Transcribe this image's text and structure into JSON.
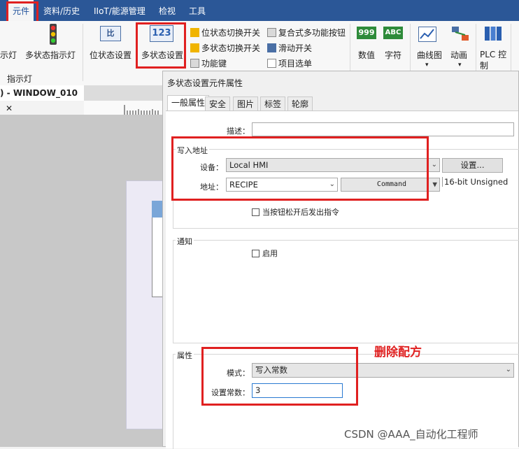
{
  "menu": {
    "items": [
      "元件",
      "资料/历史",
      "IIoT/能源管理",
      "检视",
      "工具"
    ],
    "active_index": 0
  },
  "ribbon": {
    "lamp_partial_label": "示灯",
    "multi_state_indicator_label": "多状态指示灯",
    "group_indicator_label": "指示灯",
    "bit_setting_label": "位状态设置",
    "multi_state_setting_label": "多状态设置",
    "bit_setting_icon_text": "比",
    "multi_state_icon_text": "123",
    "small_buttons": [
      "位状态切换开关",
      "多状态切换开关",
      "功能键",
      "复合式多功能按钮",
      "滑动开关",
      "项目选单"
    ],
    "numeric_label": "数值",
    "numeric_icon_text": "999",
    "char_label": "字符",
    "char_icon_text": "ABC",
    "trend_label": "曲线图",
    "animation_label": "动画",
    "plc_label": "PLC 控制"
  },
  "doc_tab": {
    "label": ") - WINDOW_010",
    "close": "✕"
  },
  "dialog": {
    "title": "多状态设置元件属性",
    "tabs": [
      "一般属性",
      "安全",
      "图片",
      "标签",
      "轮廓"
    ],
    "active_tab": 0,
    "description_label": "描述：",
    "description_value": "",
    "write_address": {
      "group_label": "写入地址",
      "device_label": "设备：",
      "device_value": "Local HMI",
      "settings_button": "设置...",
      "address_label": "地址：",
      "address_value": "RECIPE",
      "command_value": "Command",
      "data_type": "16-bit Unsigned",
      "release_checkbox_label": "当按钮松开后发出指令",
      "release_checked": false
    },
    "notification": {
      "group_label": "通知",
      "enable_label": "启用",
      "enable_checked": false
    },
    "attributes": {
      "group_label": "属性",
      "mode_label": "模式：",
      "mode_value": "写入常数",
      "constant_label": "设置常数：",
      "constant_value": "3"
    }
  },
  "annotation": "删除配方",
  "watermark": "CSDN @AAA_自动化工程师",
  "colors": {
    "menubar": "#2b5797",
    "highlight": "#e02020",
    "dialog_bg": "#f0f0f0"
  }
}
